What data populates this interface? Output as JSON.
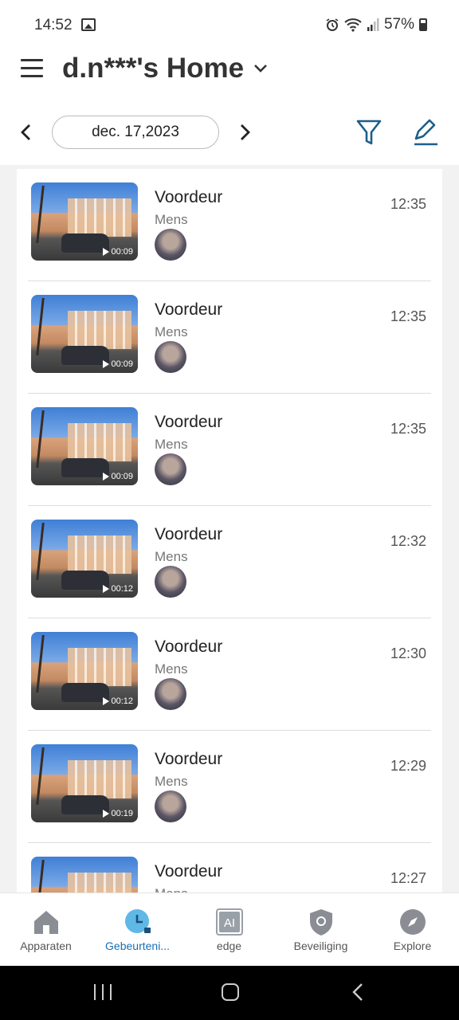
{
  "status_bar": {
    "time": "14:52",
    "battery": "57%",
    "icons": [
      "image-icon",
      "alarm-icon",
      "wifi-icon",
      "signal-icon",
      "battery-icon"
    ]
  },
  "header": {
    "home_title": "d.n***'s Home",
    "date": "dec. 17,2023"
  },
  "events": [
    {
      "title": "Voordeur",
      "type": "Mens",
      "time": "12:35",
      "duration": "00:09"
    },
    {
      "title": "Voordeur",
      "type": "Mens",
      "time": "12:35",
      "duration": "00:09"
    },
    {
      "title": "Voordeur",
      "type": "Mens",
      "time": "12:35",
      "duration": "00:09"
    },
    {
      "title": "Voordeur",
      "type": "Mens",
      "time": "12:32",
      "duration": "00:12"
    },
    {
      "title": "Voordeur",
      "type": "Mens",
      "time": "12:30",
      "duration": "00:12"
    },
    {
      "title": "Voordeur",
      "type": "Mens",
      "time": "12:29",
      "duration": "00:19"
    },
    {
      "title": "Voordeur",
      "type": "Mens",
      "time": "12:27",
      "duration": ""
    }
  ],
  "bottom_nav": [
    {
      "label": "Apparaten",
      "icon": "house-icon"
    },
    {
      "label": "Gebeurteni...",
      "icon": "clock-icon",
      "active": true
    },
    {
      "label": "edge",
      "icon": "ai-icon",
      "icon_text": "AI"
    },
    {
      "label": "Beveiliging",
      "icon": "shield-icon"
    },
    {
      "label": "Explore",
      "icon": "compass-icon"
    }
  ],
  "colors": {
    "accent": "#1a6fb5",
    "icon_blue": "#1c5f8a"
  }
}
